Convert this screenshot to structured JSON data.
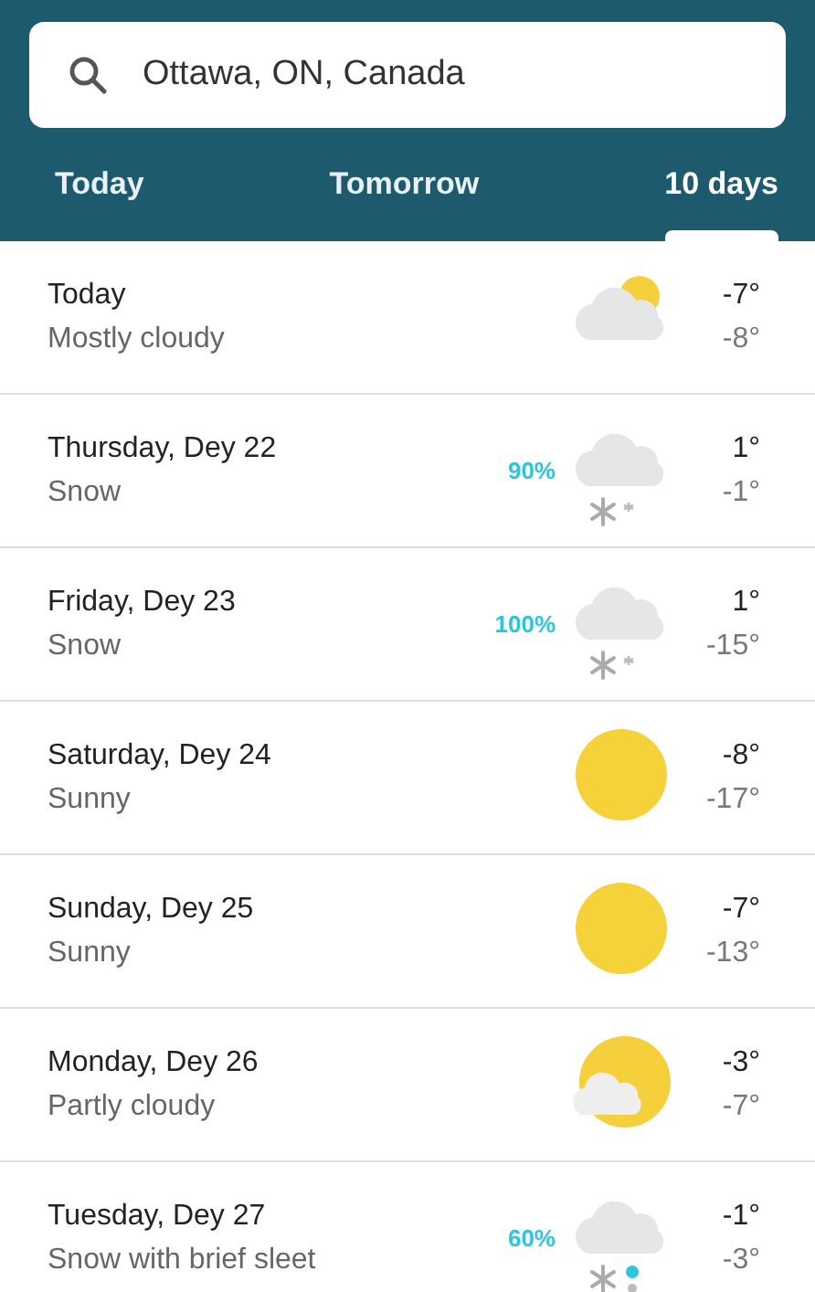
{
  "search": {
    "value": "Ottawa, ON, Canada"
  },
  "tabs": [
    {
      "label": "Today",
      "selected": false
    },
    {
      "label": "Tomorrow",
      "selected": false
    },
    {
      "label": "10 days",
      "selected": true
    }
  ],
  "days": [
    {
      "day": "Today",
      "condition": "Mostly cloudy",
      "kind": "mostly-cloudy",
      "high": "-7°",
      "low": "-8°"
    },
    {
      "day": "Thursday, Dey 22",
      "condition": "Snow",
      "kind": "snow",
      "precip": "90%",
      "high": "1°",
      "low": "-1°"
    },
    {
      "day": "Friday, Dey 23",
      "condition": "Snow",
      "kind": "snow",
      "precip": "100%",
      "high": "1°",
      "low": "-15°"
    },
    {
      "day": "Saturday, Dey 24",
      "condition": "Sunny",
      "kind": "sunny",
      "high": "-8°",
      "low": "-17°"
    },
    {
      "day": "Sunday, Dey 25",
      "condition": "Sunny",
      "kind": "sunny",
      "high": "-7°",
      "low": "-13°"
    },
    {
      "day": "Monday, Dey 26",
      "condition": "Partly cloudy",
      "kind": "partly-cloudy",
      "high": "-3°",
      "low": "-7°"
    },
    {
      "day": "Tuesday, Dey 27",
      "condition": "Snow with brief sleet",
      "kind": "sleet",
      "precip": "60%",
      "high": "-1°",
      "low": "-3°"
    }
  ]
}
